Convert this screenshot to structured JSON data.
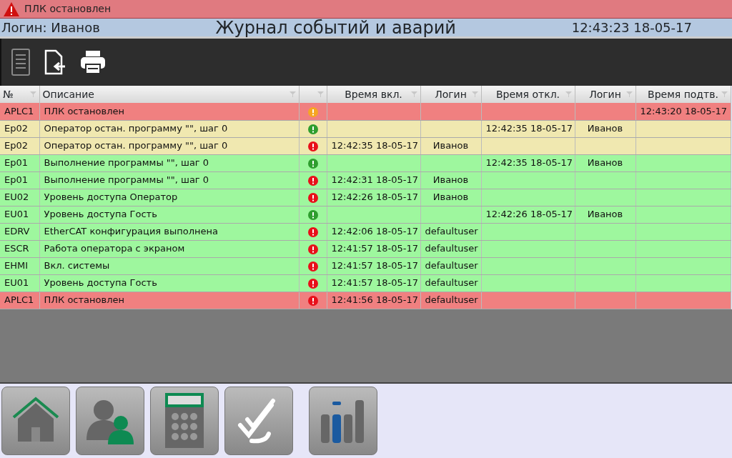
{
  "alert_banner": {
    "text": "ПЛК остановлен"
  },
  "header": {
    "login": "Логин: Иванов",
    "title": "Журнал событий и аварий",
    "clock": "12:43:23 18-05-17"
  },
  "toolbar": [
    {
      "kind": "list"
    },
    {
      "kind": "export"
    },
    {
      "kind": "print"
    }
  ],
  "table": {
    "columns": [
      "№",
      "Описание",
      null,
      "Время вкл.",
      "Логин",
      "Время откл.",
      "Логин",
      "Время подтв."
    ],
    "rows": [
      {
        "color": "#f08080",
        "status": {
          "color": "#f5a623"
        },
        "cells": [
          "APLC1",
          "ПЛК остановлен",
          null,
          null,
          null,
          null,
          null,
          "12:43:20 18-05-17"
        ]
      },
      {
        "color": "#f0e8b0",
        "status": {
          "color": "#2e9e2e"
        },
        "cells": [
          "Ep02",
          "Оператор остан. программу \"\", шаг 0",
          null,
          null,
          null,
          "12:42:35 18-05-17",
          "Иванов",
          null
        ]
      },
      {
        "color": "#f0e8b0",
        "status": {
          "color": "#e8101a"
        },
        "cells": [
          "Ep02",
          "Оператор остан. программу \"\", шаг 0",
          null,
          "12:42:35 18-05-17",
          "Иванов",
          null,
          null,
          null
        ]
      },
      {
        "color": "#9ef79e",
        "status": {
          "color": "#2e9e2e"
        },
        "cells": [
          "Ep01",
          "Выполнение программы \"\", шаг 0",
          null,
          null,
          null,
          "12:42:35 18-05-17",
          "Иванов",
          null
        ]
      },
      {
        "color": "#9ef79e",
        "status": {
          "color": "#e8101a"
        },
        "cells": [
          "Ep01",
          "Выполнение программы \"\", шаг 0",
          null,
          "12:42:31 18-05-17",
          "Иванов",
          null,
          null,
          null
        ]
      },
      {
        "color": "#9ef79e",
        "status": {
          "color": "#e8101a"
        },
        "cells": [
          "EU02",
          "Уровень доступа Оператор",
          null,
          "12:42:26 18-05-17",
          "Иванов",
          null,
          null,
          null
        ]
      },
      {
        "color": "#9ef79e",
        "status": {
          "color": "#2e9e2e"
        },
        "cells": [
          "EU01",
          "Уровень доступа Гость",
          null,
          null,
          null,
          "12:42:26 18-05-17",
          "Иванов",
          null
        ]
      },
      {
        "color": "#9ef79e",
        "status": {
          "color": "#e8101a"
        },
        "cells": [
          "EDRV",
          "EtherCAT конфигурация выполнена",
          null,
          "12:42:06 18-05-17",
          "defaultuser",
          null,
          null,
          null
        ]
      },
      {
        "color": "#9ef79e",
        "status": {
          "color": "#e8101a"
        },
        "cells": [
          "ESCR",
          "Работа оператора с экраном",
          null,
          "12:41:57 18-05-17",
          "defaultuser",
          null,
          null,
          null
        ]
      },
      {
        "color": "#9ef79e",
        "status": {
          "color": "#e8101a"
        },
        "cells": [
          "EHMI",
          "Вкл. системы",
          null,
          "12:41:57 18-05-17",
          "defaultuser",
          null,
          null,
          null
        ]
      },
      {
        "color": "#9ef79e",
        "status": {
          "color": "#e8101a"
        },
        "cells": [
          "EU01",
          "Уровень доступа Гость",
          null,
          "12:41:57 18-05-17",
          "defaultuser",
          null,
          null,
          null
        ]
      },
      {
        "color": "#f08080",
        "status": {
          "color": "#e8101a"
        },
        "cells": [
          "APLC1",
          "ПЛК остановлен",
          null,
          "12:41:56 18-05-17",
          "defaultuser",
          null,
          null,
          null
        ]
      }
    ]
  },
  "nav_buttons": [
    {
      "kind": "home"
    },
    {
      "kind": "users"
    },
    {
      "kind": "calculator"
    },
    {
      "kind": "checklist"
    },
    {
      "kind": "levels"
    }
  ]
}
